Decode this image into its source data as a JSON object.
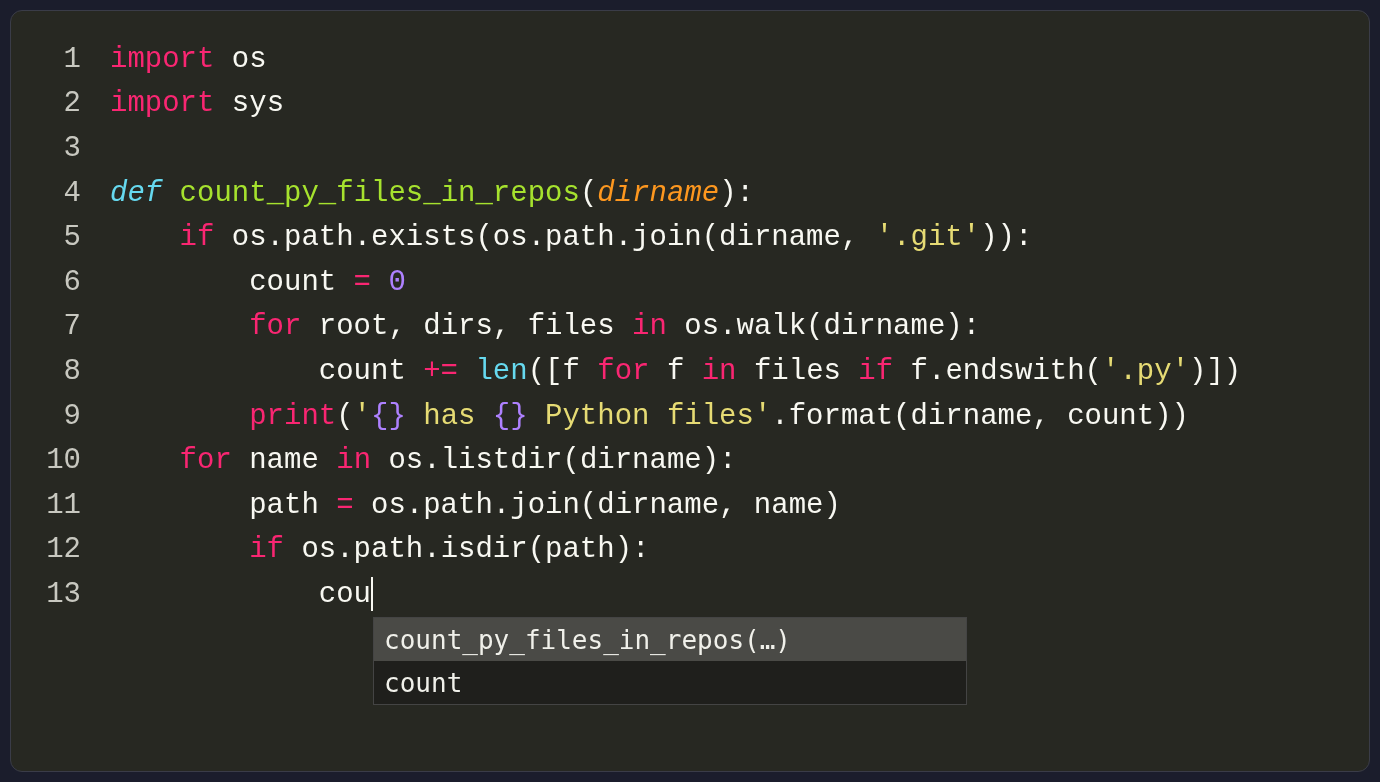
{
  "editor": {
    "lines": [
      {
        "number": "1",
        "caret": false,
        "tokens": [
          {
            "text": "import",
            "kind": "keyword"
          },
          {
            "text": " os",
            "kind": "plain"
          }
        ]
      },
      {
        "number": "2",
        "caret": false,
        "tokens": [
          {
            "text": "import",
            "kind": "keyword"
          },
          {
            "text": " sys",
            "kind": "plain"
          }
        ]
      },
      {
        "number": "3",
        "caret": false
      },
      {
        "number": "4",
        "caret": false,
        "tokens": [
          {
            "text": "def",
            "kind": "storage"
          },
          {
            "text": " count_py_files_in_repos",
            "kind": "function"
          },
          {
            "text": "(",
            "kind": "plain"
          },
          {
            "text": "dirname",
            "kind": "param"
          },
          {
            "text": "):",
            "kind": "plain"
          }
        ],
        "children": [
          {
            "number": "5",
            "caret": false,
            "tokens": [
              {
                "text": "if",
                "kind": "keyword"
              },
              {
                "text": " os.path.exists(os.path.join(dirname, ",
                "kind": "plain"
              },
              {
                "text": "'.git'",
                "kind": "string"
              },
              {
                "text": ")):",
                "kind": "plain"
              }
            ],
            "children": [
              {
                "number": "6",
                "caret": false,
                "tokens": [
                  {
                    "text": "count ",
                    "kind": "plain"
                  },
                  {
                    "text": "=",
                    "kind": "keyword"
                  },
                  {
                    "text": " 0",
                    "kind": "number"
                  }
                ]
              },
              {
                "number": "7",
                "caret": false,
                "tokens": [
                  {
                    "text": "for",
                    "kind": "keyword"
                  },
                  {
                    "text": " root, dirs, files ",
                    "kind": "plain"
                  },
                  {
                    "text": "in",
                    "kind": "keyword"
                  },
                  {
                    "text": " os.walk(dirname):",
                    "kind": "plain"
                  }
                ],
                "children": [
                  {
                    "number": "8",
                    "caret": false,
                    "tokens": [
                      {
                        "text": "count ",
                        "kind": "plain"
                      },
                      {
                        "text": "+=",
                        "kind": "keyword"
                      },
                      {
                        "text": " len",
                        "kind": "builtin"
                      },
                      {
                        "text": "([f ",
                        "kind": "plain"
                      },
                      {
                        "text": "for",
                        "kind": "keyword"
                      },
                      {
                        "text": " f ",
                        "kind": "plain"
                      },
                      {
                        "text": "in",
                        "kind": "keyword"
                      },
                      {
                        "text": " files ",
                        "kind": "plain"
                      },
                      {
                        "text": "if",
                        "kind": "keyword"
                      },
                      {
                        "text": " f.endswith(",
                        "kind": "plain"
                      },
                      {
                        "text": "'.py'",
                        "kind": "string"
                      },
                      {
                        "text": ")])",
                        "kind": "plain"
                      }
                    ]
                  }
                ]
              },
              {
                "number": "9",
                "caret": false,
                "tokens": [
                  {
                    "text": "print",
                    "kind": "keyword"
                  },
                  {
                    "text": "(",
                    "kind": "plain"
                  },
                  {
                    "text": "'",
                    "kind": "string"
                  },
                  {
                    "text": "{}",
                    "kind": "number"
                  },
                  {
                    "text": " has ",
                    "kind": "string"
                  },
                  {
                    "text": "{}",
                    "kind": "number"
                  },
                  {
                    "text": " Python files'",
                    "kind": "string"
                  },
                  {
                    "text": ".format(dirname, count))",
                    "kind": "plain"
                  }
                ]
              }
            ]
          },
          {
            "number": "10",
            "caret": false,
            "tokens": [
              {
                "text": "for",
                "kind": "keyword"
              },
              {
                "text": " name ",
                "kind": "plain"
              },
              {
                "text": "in",
                "kind": "keyword"
              },
              {
                "text": " os.listdir(dirname):",
                "kind": "plain"
              }
            ],
            "children": [
              {
                "number": "11",
                "caret": false,
                "tokens": [
                  {
                    "text": "path ",
                    "kind": "plain"
                  },
                  {
                    "text": "=",
                    "kind": "keyword"
                  },
                  {
                    "text": " os.path.join(dirname, name)",
                    "kind": "plain"
                  }
                ]
              },
              {
                "number": "12",
                "caret": false,
                "tokens": [
                  {
                    "text": "if",
                    "kind": "keyword"
                  },
                  {
                    "text": " os.path.isdir(path):",
                    "kind": "plain"
                  }
                ],
                "children": [
                  {
                    "number": "13",
                    "caret": true,
                    "tokens": [
                      {
                        "text": "cou",
                        "kind": "plain"
                      }
                    ]
                  }
                ]
              }
            ]
          }
        ]
      }
    ]
  },
  "completions": [
    {
      "label": "count_py_files_in_repos(…)",
      "selected": true
    },
    {
      "label": "count",
      "selected": false
    }
  ]
}
